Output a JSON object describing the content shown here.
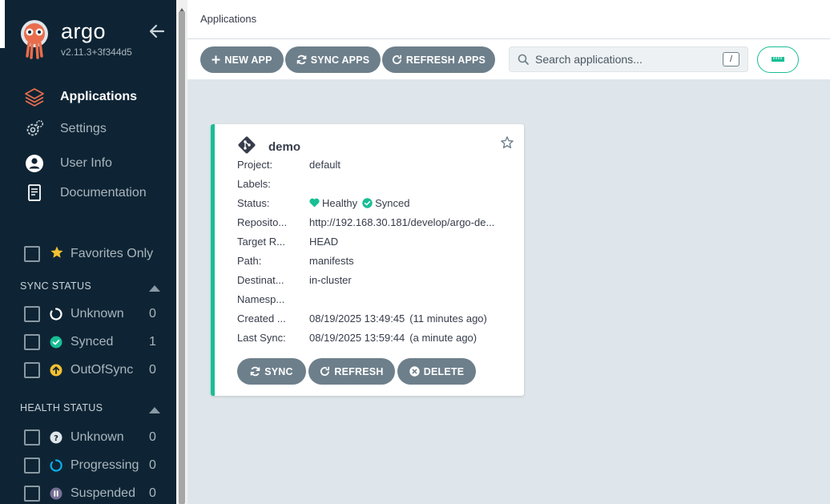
{
  "brand": {
    "name": "argo",
    "version": "v2.11.3+3f344d5"
  },
  "nav": {
    "items": [
      {
        "label": "Applications",
        "icon": "layers-icon",
        "active": true
      },
      {
        "label": "Settings",
        "icon": "gears-icon",
        "active": false
      },
      {
        "label": "User Info",
        "icon": "user-circle-icon",
        "active": false
      },
      {
        "label": "Documentation",
        "icon": "book-icon",
        "active": false
      }
    ]
  },
  "filters": {
    "favorites_label": "Favorites Only",
    "sync_status": {
      "title": "SYNC STATUS",
      "items": [
        {
          "label": "Unknown",
          "count": "0",
          "icon": "circle-notch-icon"
        },
        {
          "label": "Synced",
          "count": "1",
          "icon": "check-circle-icon"
        },
        {
          "label": "OutOfSync",
          "count": "0",
          "icon": "arrow-up-circle-icon"
        }
      ]
    },
    "health_status": {
      "title": "HEALTH STATUS",
      "items": [
        {
          "label": "Unknown",
          "count": "0",
          "icon": "question-circle-icon"
        },
        {
          "label": "Progressing",
          "count": "0",
          "icon": "progress-circle-icon"
        },
        {
          "label": "Suspended",
          "count": "0",
          "icon": "pause-circle-icon"
        }
      ]
    }
  },
  "header": {
    "title": "Applications"
  },
  "toolbar": {
    "new_app": "NEW APP",
    "sync_apps": "SYNC APPS",
    "refresh_apps": "REFRESH APPS",
    "search_placeholder": "Search applications...",
    "search_shortcut": "/"
  },
  "app": {
    "name": "demo",
    "rows": {
      "project": {
        "key": "Project:",
        "value": "default"
      },
      "labels": {
        "key": "Labels:",
        "value": ""
      },
      "status": {
        "key": "Status:",
        "health": "Healthy",
        "sync": "Synced"
      },
      "repository": {
        "key": "Reposito...",
        "value": "http://192.168.30.181/develop/argo-de..."
      },
      "target": {
        "key": "Target R...",
        "value": "HEAD"
      },
      "path": {
        "key": "Path:",
        "value": "manifests"
      },
      "destination": {
        "key": "Destinat...",
        "value": "in-cluster"
      },
      "namespace": {
        "key": "Namesp...",
        "value": ""
      },
      "created": {
        "key": "Created ...",
        "value": "08/19/2025 13:49:45",
        "relative": "(11 minutes ago)"
      },
      "last_sync": {
        "key": "Last Sync:",
        "value": "08/19/2025 13:59:44",
        "relative": "(a minute ago)"
      }
    },
    "actions": {
      "sync": "SYNC",
      "refresh": "REFRESH",
      "delete": "DELETE"
    }
  },
  "colors": {
    "sidebar_bg": "#0e2434",
    "accent_green": "#18be94",
    "button_gray": "#6d7f8b",
    "main_bg": "#dee6eb",
    "warning_yellow": "#f4c030",
    "progress_blue": "#0dadea",
    "suspended_purple": "#766f94"
  }
}
